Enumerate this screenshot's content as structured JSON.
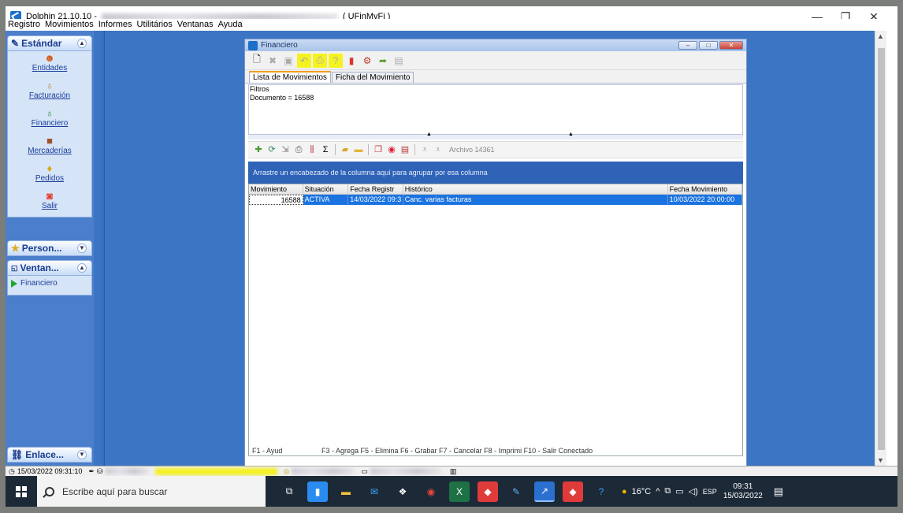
{
  "window": {
    "title_app": "Dolphin 21.10.10 -",
    "title_suffix": "( UFinMvFi )",
    "minimize": "—",
    "maximize": "❐",
    "close": "✕"
  },
  "menu": [
    "Registro",
    "Movimientos",
    "Informes",
    "Utilitários",
    "Ventanas",
    "Ayuda"
  ],
  "nav": {
    "standard_header": "Estándar",
    "items": [
      {
        "label": "Entidades",
        "icon": "people-icon"
      },
      {
        "label": "Facturación",
        "icon": "invoice-icon"
      },
      {
        "label": "Financiero",
        "icon": "money-icon"
      },
      {
        "label": "Mercaderías",
        "icon": "goods-icon"
      },
      {
        "label": "Pedidos",
        "icon": "orders-icon"
      },
      {
        "label": "Salir",
        "icon": "exit-icon"
      }
    ],
    "personal_header": "Person...",
    "windows_header": "Ventan...",
    "windows_items": [
      "Financiero"
    ],
    "links_header": "Enlace..."
  },
  "child": {
    "title": "Financiero",
    "tabs": [
      "Lista de Movimientos",
      "Ficha del Movimiento"
    ],
    "filters_label": "Filtros",
    "filters_text": "Documento = 16588",
    "archive_label": "Archivo 14361",
    "group_hint": "Arrastre un encabezado de la columna aquí para agrupar por esa columna",
    "columns": [
      "Movimiento",
      "Situación",
      "Fecha Registr",
      "Histórico",
      "Fecha Movimiento"
    ],
    "rows": [
      {
        "movimiento": "16588",
        "situacion": "ACTIVA",
        "fecha_registro": "14/03/2022 09:3",
        "historico": "Canc. varias facturas",
        "fecha_movimiento": "10/03/2022 20:00:00"
      }
    ],
    "status_left": "F1 - Ayud",
    "status_right": "F3 - Agrega F5 - Elimina F6 - Grabar F7 - Cancelar F8 - Imprimi F10 - Salir Conectado"
  },
  "statusbar": {
    "datetime": "15/03/2022 09:31:10"
  },
  "taskbar": {
    "search_placeholder": "Escribe aquí para buscar",
    "weather": "16°C",
    "lang": "ESP",
    "time": "09:31",
    "date": "15/03/2022"
  },
  "colors": {
    "workspace": "#3c75c4",
    "highlight": "#f5f31f",
    "selected_row": "#1a73e0",
    "taskbar": "#1c2937"
  }
}
